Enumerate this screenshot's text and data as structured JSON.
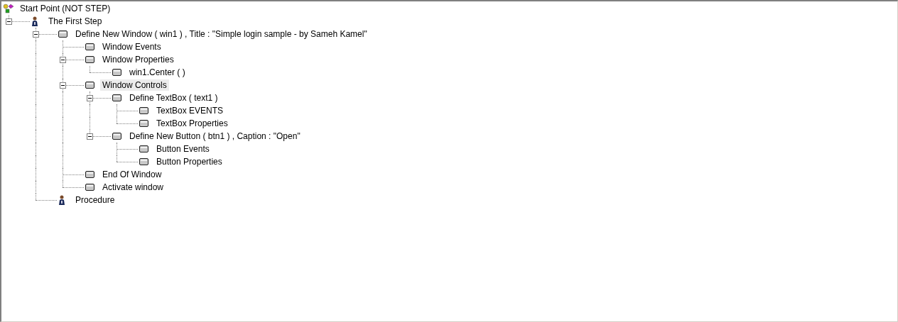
{
  "tree": [
    {
      "label": "Start Point (NOT STEP)",
      "kind": "root",
      "selected": false,
      "children": [
        {
          "label": "The First Step",
          "kind": "step",
          "expanded": true,
          "selected": false,
          "children": [
            {
              "label": "Define New Window  ( win1 ) , Title : \"Simple login sample - by Sameh Kamel\"",
              "kind": "block",
              "expanded": true,
              "selected": false,
              "children": [
                {
                  "label": "Window Events",
                  "kind": "block",
                  "selected": false
                },
                {
                  "label": "Window Properties",
                  "kind": "block",
                  "expanded": true,
                  "selected": false,
                  "children": [
                    {
                      "label": "win1.Center ( )",
                      "kind": "block",
                      "selected": false
                    }
                  ]
                },
                {
                  "label": "Window Controls",
                  "kind": "block",
                  "expanded": true,
                  "selected": true,
                  "children": [
                    {
                      "label": "Define TextBox  ( text1  )",
                      "kind": "block",
                      "expanded": true,
                      "selected": false,
                      "children": [
                        {
                          "label": "TextBox EVENTS",
                          "kind": "block",
                          "selected": false
                        },
                        {
                          "label": "TextBox Properties",
                          "kind": "block",
                          "selected": false
                        }
                      ]
                    },
                    {
                      "label": "Define New Button ( btn1 ) , Caption : \"Open\"",
                      "kind": "block",
                      "expanded": true,
                      "selected": false,
                      "children": [
                        {
                          "label": "Button Events",
                          "kind": "block",
                          "selected": false
                        },
                        {
                          "label": "Button Properties",
                          "kind": "block",
                          "selected": false
                        }
                      ]
                    }
                  ]
                },
                {
                  "label": "End Of Window",
                  "kind": "block",
                  "selected": false
                },
                {
                  "label": "Activate window",
                  "kind": "block",
                  "selected": false
                }
              ]
            },
            {
              "label": "Procedure",
              "kind": "step",
              "selected": false
            }
          ]
        }
      ]
    }
  ]
}
